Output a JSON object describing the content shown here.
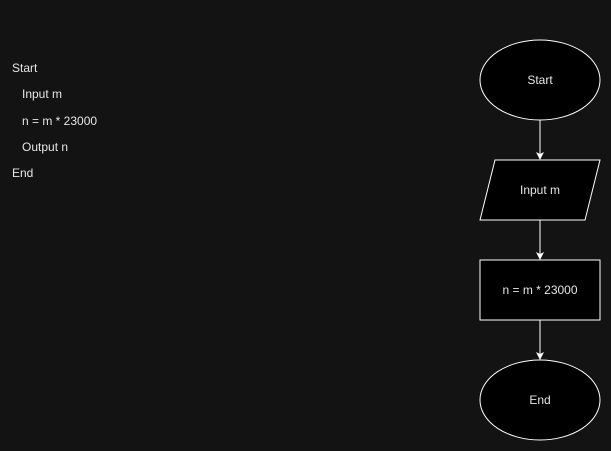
{
  "pseudocode": {
    "lines": [
      "Start",
      "Input m",
      "n = m * 23000",
      "Output n",
      "End"
    ]
  },
  "flowchart": {
    "nodes": [
      {
        "shape": "ellipse",
        "label": "Start"
      },
      {
        "shape": "parallelogram",
        "label": "Input m"
      },
      {
        "shape": "rectangle",
        "label": "n = m * 23000"
      },
      {
        "shape": "ellipse",
        "label": "End"
      }
    ],
    "colors": {
      "background": "#131313",
      "node_fill": "#000000",
      "stroke": "#ffffff",
      "text": "#e6e6e6"
    }
  }
}
